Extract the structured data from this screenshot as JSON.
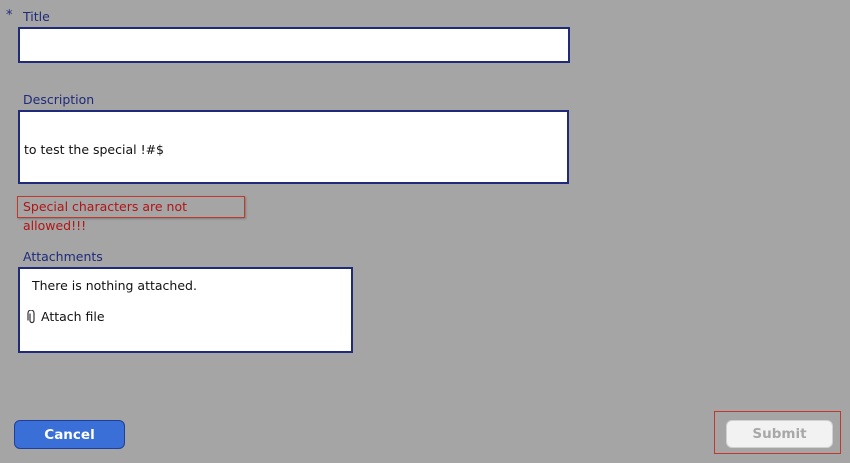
{
  "form": {
    "required_marker": "*",
    "title": {
      "label": "Title",
      "value": "",
      "placeholder": ""
    },
    "description": {
      "label": "Description",
      "value": "to test the special !#$"
    },
    "error": {
      "message": "Special characters are not allowed!!!"
    },
    "attachments": {
      "label": "Attachments",
      "empty_text": "There is nothing attached.",
      "attach_label": "Attach file",
      "attach_icon": "paperclip-icon"
    }
  },
  "actions": {
    "cancel_label": "Cancel",
    "submit_label": "Submit"
  },
  "colors": {
    "background": "#a5a5a5",
    "field_border": "#1f2a7a",
    "error": "#b01515",
    "cancel_button": "#3a6fd8",
    "submit_disabled": "#f2f2f2"
  }
}
